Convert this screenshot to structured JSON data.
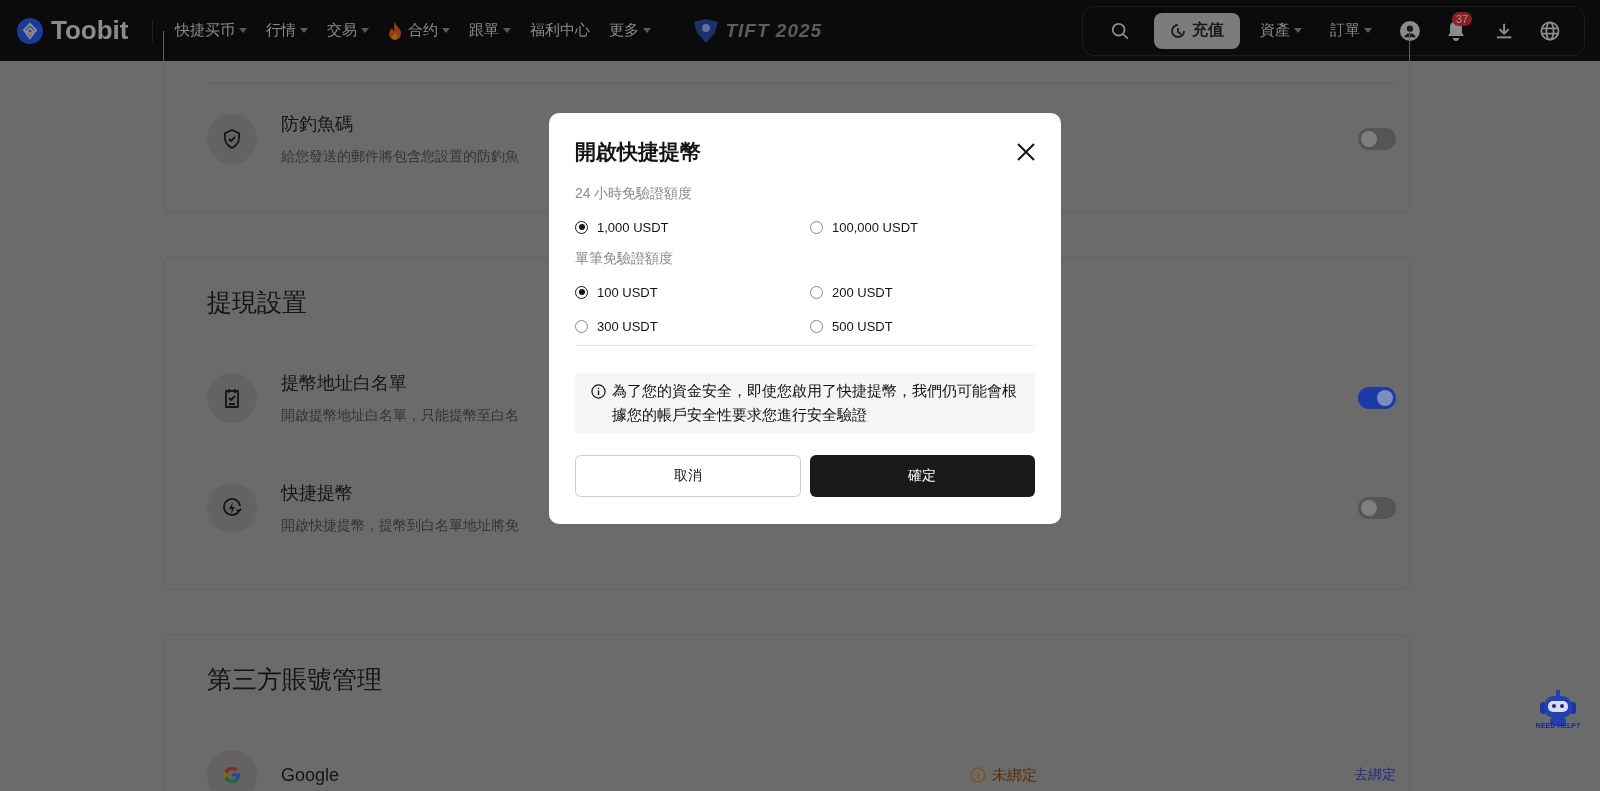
{
  "header": {
    "logo": "Toobit",
    "nav": [
      {
        "label": "快捷买币",
        "dropdown": true,
        "hot": false
      },
      {
        "label": "行情",
        "dropdown": true,
        "hot": false
      },
      {
        "label": "交易",
        "dropdown": true,
        "hot": false
      },
      {
        "label": "合约",
        "dropdown": true,
        "hot": true
      },
      {
        "label": "跟單",
        "dropdown": true,
        "hot": false
      },
      {
        "label": "福利中心",
        "dropdown": false,
        "hot": false
      },
      {
        "label": "更多",
        "dropdown": true,
        "hot": false
      }
    ],
    "event_logo": "TIFT 2025",
    "deposit_button": "充值",
    "menus": [
      {
        "label": "資產"
      },
      {
        "label": "訂單"
      }
    ],
    "notification_count": "37"
  },
  "sections": [
    {
      "items": [
        {
          "kind": "shield",
          "title": "防釣魚碼",
          "description": "給您發送的郵件將包含您設置的防釣魚",
          "on": false
        }
      ]
    },
    {
      "title": "提現設置",
      "items": [
        {
          "kind": "clipboard",
          "title": "提幣地址白名單",
          "description": "開啟提幣地址白名單，只能提幣至白名",
          "on": true
        },
        {
          "kind": "bolt",
          "title": "快捷提幣",
          "description": "開啟快捷提幣，提幣到白名單地址將免",
          "on": false
        }
      ]
    },
    {
      "title": "第三方賬號管理",
      "items": [
        {
          "kind": "google",
          "title": "Google",
          "status": "未綁定",
          "action": "去綁定"
        }
      ]
    }
  ],
  "dialog": {
    "title": "開啟快捷提幣",
    "groups": [
      {
        "label": "24 小時免驗證額度",
        "options": [
          {
            "label": "1,000 USDT",
            "selected": true
          },
          {
            "label": "100,000 USDT",
            "selected": false
          }
        ]
      },
      {
        "label": "單筆免驗證額度",
        "options": [
          {
            "label": "100 USDT",
            "selected": true
          },
          {
            "label": "200 USDT",
            "selected": false
          },
          {
            "label": "300 USDT",
            "selected": false
          },
          {
            "label": "500 USDT",
            "selected": false
          }
        ]
      }
    ],
    "notice": "為了您的資金安全，即使您啟用了快捷提幣，我們仍可能會根據您的帳戶安全性要求您進行安全驗證",
    "cancel": "取消",
    "confirm": "確定"
  },
  "help_widget": {
    "label": "NEED HELP?"
  }
}
